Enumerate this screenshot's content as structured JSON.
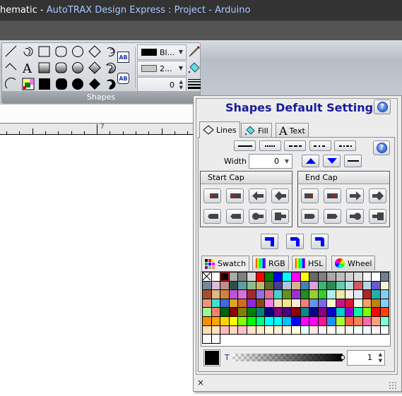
{
  "window": {
    "title_prefix": "hematic - ",
    "title_app": "AutoTRAX Design Express : Project - Arduino"
  },
  "ribbon": {
    "group_label": "Shapes",
    "tools": [
      [
        "line-icon",
        "spiral-arc-icon",
        "rectangle-icon",
        "rounded-rectangle-icon",
        "ellipse-icon",
        "diamond-icon",
        "spiral-icon"
      ],
      [
        "polyline-icon",
        "text-icon",
        "gradient-rectangle-icon",
        "gradient-rounded-rectangle-icon",
        "gradient-ellipse-icon",
        "gradient-diamond-icon",
        "gradient-spiral-icon"
      ],
      [
        "arc-icon",
        "image-icon",
        "filled-rectangle-icon",
        "filled-rounded-rectangle-icon",
        "filled-ellipse-icon",
        "filled-diamond-icon",
        "filled-spiral-icon"
      ]
    ],
    "ab_label": "AB",
    "line_color_label": "Bl...",
    "fill_color_label": "2...",
    "line_width_value": "0"
  },
  "ruler": {
    "label": "7"
  },
  "panel": {
    "title": "Shapes Default Settings",
    "help_label": "?",
    "tabs": [
      {
        "label": "Lines",
        "icon": "diamond-outline-icon",
        "active": true
      },
      {
        "label": "Fill",
        "icon": "paint-bucket-icon",
        "active": false
      },
      {
        "label": "Text",
        "icon": "text-A-icon",
        "active": false
      }
    ],
    "line_styles": [
      "solid",
      "dotted",
      "dashed",
      "dash-dot",
      "dash-dot-dot"
    ],
    "width_label": "Width",
    "width_value": "0",
    "start_cap": {
      "label": "Start Cap",
      "buttons": [
        "round-dot",
        "square-dot",
        "arrow",
        "diamond",
        "rounded",
        "angled",
        "circle",
        "square"
      ]
    },
    "end_cap": {
      "label": "End Cap",
      "buttons": [
        "round-dot",
        "square-dot",
        "arrow",
        "diamond",
        "rounded",
        "angled",
        "circle",
        "square"
      ]
    },
    "joins": [
      "miter-join",
      "bevel-join",
      "round-join"
    ],
    "color_tabs": [
      {
        "label": "Swatch",
        "active": true
      },
      {
        "label": "RGB",
        "active": false
      },
      {
        "label": "HSL",
        "active": false
      },
      {
        "label": "Wheel",
        "active": false
      }
    ],
    "swatches": [
      "none",
      "#FFFFFF",
      "#000000",
      "#A9A9A9",
      "#808080",
      "#D3D3D3",
      "#FF0000",
      "#008000",
      "#0000FF",
      "#00FFFF",
      "#FF00FF",
      "#FFFF00",
      "#696969",
      "#808080",
      "#A9A9A9",
      "#C0C0C0",
      "#D3D3D3",
      "#DCDCDC",
      "#F5F5F5",
      "#FFFFFF",
      "#708090",
      "#778899",
      "#D8BFD8",
      "#BC8F8F",
      "#2F4F4F",
      "#5F9EA0",
      "#8FBC8F",
      "#BDB76B",
      "#556B2F",
      "#483D8B",
      "#B0C4DE",
      "#D2B48C",
      "#4682B4",
      "#DDA0DD",
      "#3CB371",
      "#2E8B57",
      "#66CDAA",
      "#B0E0E6",
      "#CD5C5C",
      "#ADD8E6",
      "#6A5ACD",
      "#F5F5DC",
      "#A0522D",
      "#DEB887",
      "#CD853F",
      "#BA55D3",
      "#DA70D6",
      "#A52A2A",
      "#9370DB",
      "#DB7093",
      "#48D1CC",
      "#6B8E23",
      "#9932CC",
      "#228B22",
      "#9ACD32",
      "#32CD32",
      "#AFEEEE",
      "#EEE8AA",
      "#FAF0E6",
      "#E6E6FA",
      "#B22222",
      "#20B2AA",
      "#87CEEB",
      "#E9967A",
      "#40E0D0",
      "#4169E1",
      "#DAA520",
      "#D2691E",
      "#8A2BE2",
      "#8B4513",
      "#EE82EE",
      "#F5DEB3",
      "#F0E68C",
      "#FAEBD7",
      "#F08080",
      "#6495ED",
      "#7B68EE",
      "#FAFAD2",
      "#C71585",
      "#DC143C",
      "#FFF8E7",
      "#F4A460",
      "#B8860B",
      "#87CEFA",
      "#98FB98",
      "#FA8072",
      "#006400",
      "#8B0000",
      "#808000",
      "#008000",
      "#008080",
      "#000080",
      "#800080",
      "#4B0082",
      "#8B0000",
      "#008B8B",
      "#00008B",
      "#8B008B",
      "#0000CD",
      "#00CED1",
      "#9400D3",
      "#00FA9A",
      "#7FFF00",
      "#FF0000",
      "#FF4500",
      "#FF8C00",
      "#FFA500",
      "#FFD700",
      "#FFFF00",
      "#7FFF00",
      "#00FF00",
      "#00FF7F",
      "#00FFFF",
      "#00FFFF",
      "#00BFFF",
      "#0000FF",
      "#FF00FF",
      "#FF00FF",
      "#FF1493",
      "#1E90FF",
      "#ADFF2F",
      "#FF6347",
      "#FF7F50",
      "#FF69B4",
      "#FFA07A",
      "#7FFFD4",
      "#FFDEAD",
      "#FFE4B5",
      "#FFB6C1",
      "#FFDAB9",
      "#FFC0CB",
      "#FFE4C4",
      "#FFEBCD",
      "#FFF8DC",
      "#FFEFD5",
      "#FFF5E0",
      "#FFFFE0",
      "#E0FFFF",
      "#FFE4E1",
      "#FFF0F5",
      "#FFFAF0",
      "#FFFFF0",
      "#F0FFF0",
      "#F0FFFF",
      "#F0F8FF",
      "#FFF0F5",
      "#F5FFFA",
      "#F8F8FF",
      "#FFFAFA"
    ],
    "selected_swatch_index": 2,
    "current_color": "#000000",
    "transparency_label": "T",
    "transparency_value": "1",
    "close_label": "×"
  }
}
